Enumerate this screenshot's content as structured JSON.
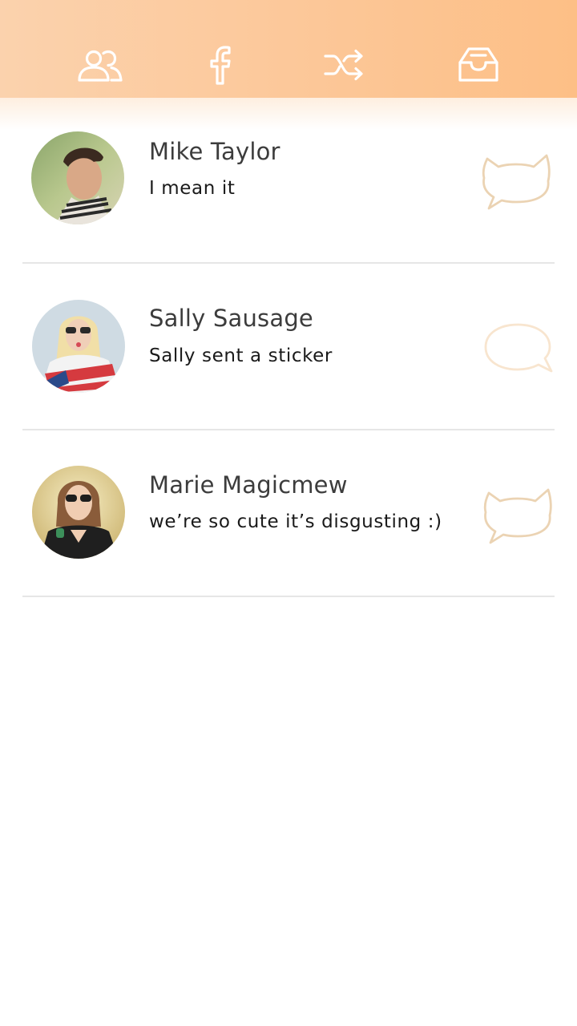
{
  "header": {
    "tabs": [
      {
        "id": "friends",
        "icon": "friends-icon"
      },
      {
        "id": "facebook",
        "icon": "facebook-icon"
      },
      {
        "id": "shuffle",
        "icon": "shuffle-icon"
      },
      {
        "id": "inbox",
        "icon": "inbox-icon"
      }
    ],
    "gradient_start": "#fbd2ad",
    "gradient_end": "#fdbf86"
  },
  "conversations": [
    {
      "name": "Mike Taylor",
      "preview": "I mean it",
      "bubble": "cat-speech-bubble-icon",
      "unread": true
    },
    {
      "name": "Sally Sausage",
      "preview": "Sally sent a sticker",
      "bubble": "speech-bubble-icon",
      "unread": false
    },
    {
      "name": "Marie Magicmew",
      "preview": "we’re so cute it’s disgusting :)",
      "bubble": "cat-speech-bubble-icon",
      "unread": true
    }
  ],
  "colors": {
    "accent": "#f5b677",
    "bubble_outline": "#ebd3b3",
    "bubble_outline_faded": "#f8e5cf",
    "divider": "#e6e6e6"
  }
}
